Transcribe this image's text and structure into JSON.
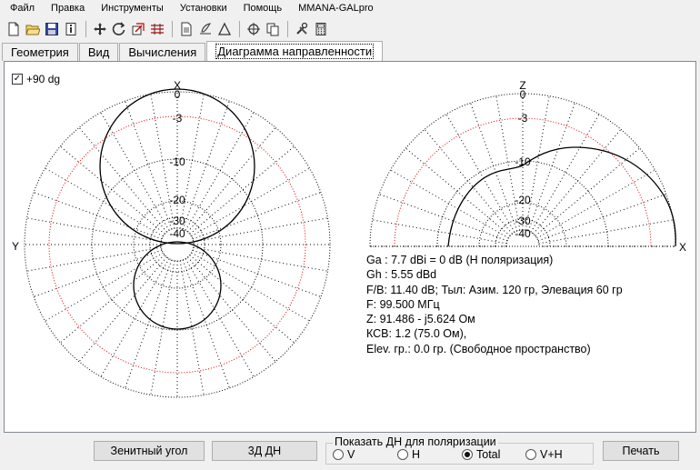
{
  "menu": [
    "Файл",
    "Правка",
    "Инструменты",
    "Установки",
    "Помощь",
    "MMANA-GALpro"
  ],
  "tabs": [
    {
      "label": "Геометрия",
      "active": false
    },
    {
      "label": "Вид",
      "active": false
    },
    {
      "label": "Вычисления",
      "active": false
    },
    {
      "label": "Диаграмма направленности",
      "active": true
    }
  ],
  "checkbox": {
    "label": "+90 dg",
    "checked": true
  },
  "horizontal_plot": {
    "top_axis": "X",
    "left_axis": "Y",
    "ring_labels": [
      "0",
      "-3",
      "-10",
      "-20",
      "-30",
      "-40"
    ]
  },
  "vertical_plot": {
    "top_axis": "Z",
    "right_axis": "X",
    "ring_labels": [
      "0",
      "-3",
      "-10",
      "-20",
      "-30",
      "-40"
    ]
  },
  "info": {
    "ga": "Ga : 7.7 dBi = 0 dB  (H поляризация)",
    "gh": "Gh : 5.55 dBd",
    "fb": "F/B: 11.40 dB; Тыл: Азим. 120 гр, Элевация 60 гр",
    "f": "F: 99.500 МГц",
    "z": "Z: 91.486 - j5.624 Ом",
    "ksv": "КСВ: 1.2 (75.0 Ом),",
    "elev": "Elev. гр.: 0.0 гр. (Свободное пространство)"
  },
  "buttons": {
    "zenith": "Зенитный угол",
    "three_d": "3Д   ДН",
    "print": "Печать"
  },
  "polarization": {
    "title": "Показать ДН для поляризации",
    "options": [
      "V",
      "H",
      "Total",
      "V+H"
    ],
    "selected": "Total"
  },
  "colors": {
    "rings_dotted": "#000000",
    "ring_minus3": "#e00000",
    "pattern": "#000000"
  }
}
